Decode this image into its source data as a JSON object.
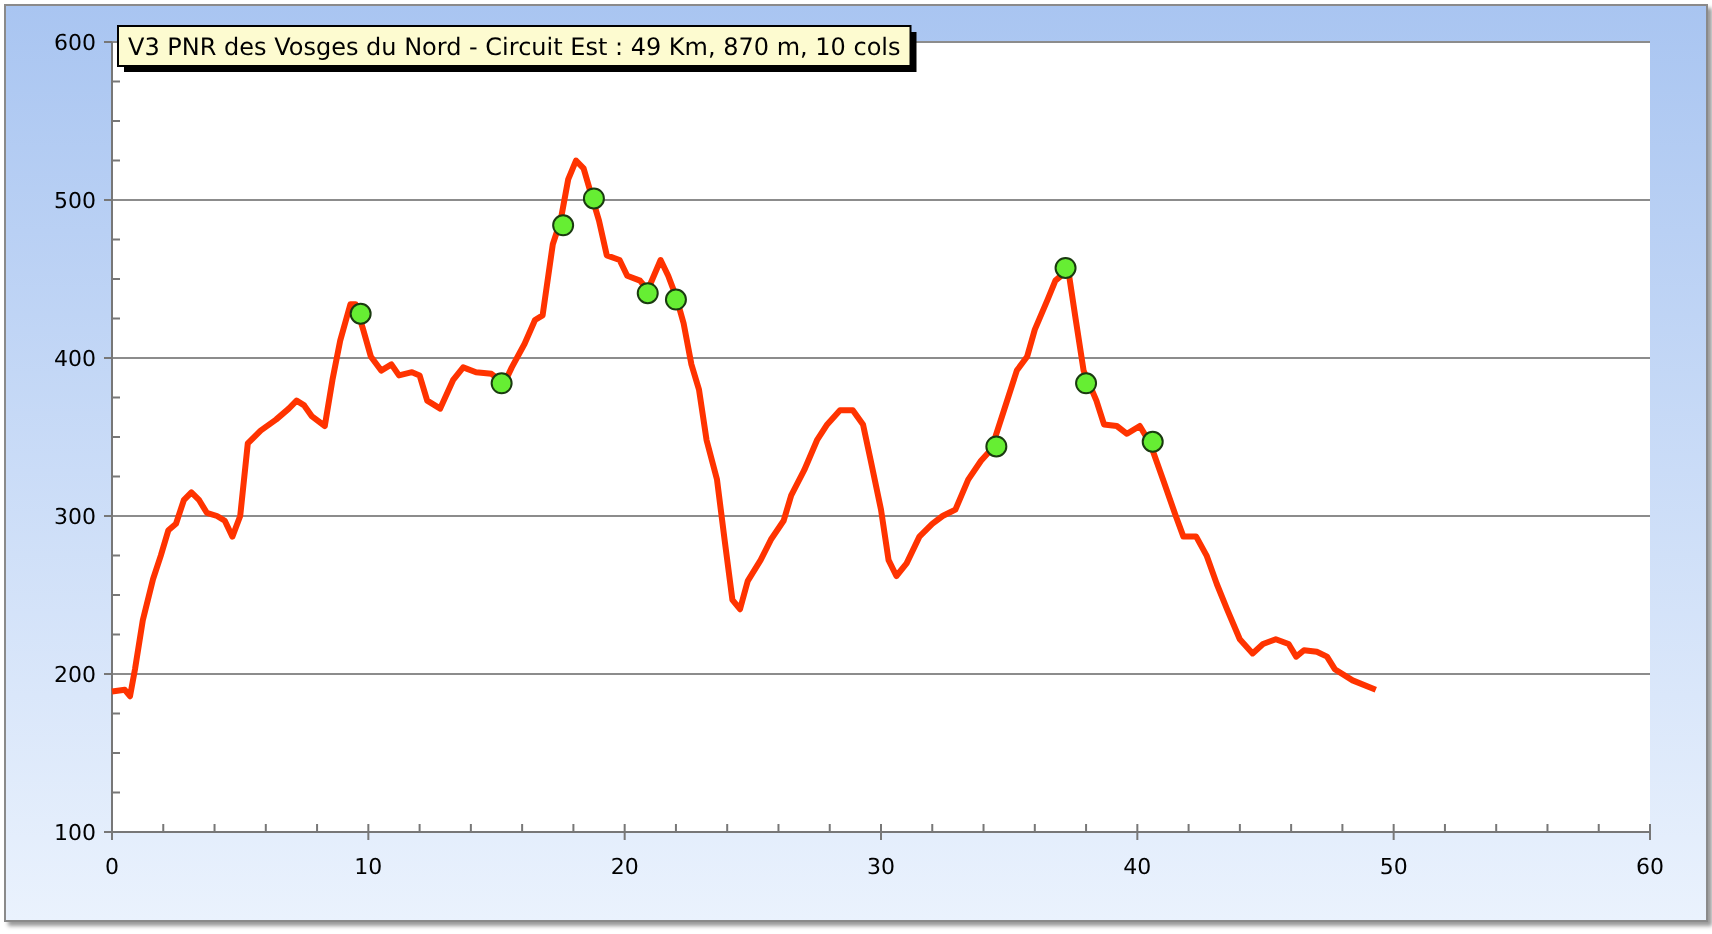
{
  "chart_data": {
    "type": "line",
    "title": "V3 PNR des Vosges du Nord - Circuit Est : 49 Km, 870 m, 10 cols",
    "grid": true,
    "xlim": [
      0,
      60
    ],
    "ylim": [
      100,
      600
    ],
    "xticks": [
      0,
      10,
      20,
      30,
      40,
      50,
      60
    ],
    "yticks": [
      100,
      200,
      300,
      400,
      500,
      600
    ],
    "series": [
      {
        "color": "#ff3300",
        "x": [
          0,
          0.5,
          0.7,
          0.9,
          1.2,
          1.6,
          1.9,
          2.2,
          2.5,
          2.8,
          3.1,
          3.4,
          3.7,
          4.1,
          4.4,
          4.7,
          5.0,
          5.3,
          5.8,
          6.4,
          6.9,
          7.2,
          7.5,
          7.8,
          8.3,
          8.6,
          8.9,
          9.3,
          9.5,
          9.8,
          10.1,
          10.5,
          10.9,
          11.2,
          11.7,
          12.0,
          12.3,
          12.8,
          13.3,
          13.7,
          14.2,
          14.8,
          15.3,
          15.6,
          16.1,
          16.5,
          16.8,
          17.2,
          17.5,
          17.8,
          18.1,
          18.4,
          18.7,
          19.0,
          19.3,
          19.8,
          20.1,
          20.6,
          20.9,
          21.4,
          21.7,
          22.0,
          22.3,
          22.6,
          22.9,
          23.2,
          23.6,
          23.9,
          24.2,
          24.5,
          24.8,
          25.3,
          25.7,
          26.2,
          26.5,
          27.0,
          27.5,
          27.9,
          28.4,
          28.9,
          29.3,
          29.6,
          30.0,
          30.3,
          30.6,
          31.0,
          31.5,
          32.0,
          32.4,
          32.9,
          33.4,
          33.9,
          34.3,
          34.8,
          35.3,
          35.7,
          36.0,
          36.5,
          36.8,
          37.3,
          37.6,
          37.9,
          38.4,
          38.7,
          39.2,
          39.6,
          40.1,
          40.5,
          41.0,
          41.5,
          41.8,
          42.3,
          42.7,
          43.1,
          43.5,
          44.0,
          44.5,
          44.9,
          45.4,
          45.9,
          46.2,
          46.5,
          47.0,
          47.4,
          47.7,
          48.4,
          49.3
        ],
        "values": [
          189,
          190,
          186,
          203,
          234,
          260,
          275,
          291,
          295,
          310,
          315,
          310,
          302,
          300,
          297,
          287,
          300,
          346,
          354,
          361,
          368,
          373,
          370,
          363,
          357,
          386,
          411,
          434,
          434,
          418,
          401,
          392,
          396,
          389,
          391,
          389,
          373,
          368,
          386,
          394,
          391,
          390,
          384,
          394,
          409,
          424,
          427,
          472,
          487,
          513,
          525,
          520,
          503,
          487,
          465,
          462,
          452,
          449,
          443,
          462,
          452,
          439,
          422,
          396,
          380,
          348,
          323,
          285,
          247,
          241,
          259,
          272,
          285,
          297,
          313,
          329,
          348,
          358,
          367,
          367,
          358,
          335,
          304,
          272,
          262,
          270,
          287,
          295,
          300,
          304,
          323,
          335,
          342,
          367,
          392,
          401,
          418,
          437,
          449,
          456,
          424,
          392,
          373,
          358,
          357,
          352,
          357,
          346,
          323,
          300,
          287,
          287,
          275,
          257,
          241,
          222,
          213,
          219,
          222,
          219,
          211,
          215,
          214,
          211,
          203,
          196,
          190
        ]
      },
      {
        "type": "scatter",
        "color": "#66ee33",
        "x": [
          9.7,
          15.2,
          17.6,
          18.8,
          20.9,
          22.0,
          34.5,
          37.2,
          38.0,
          40.6
        ],
        "values": [
          428,
          384,
          484,
          501,
          441,
          437,
          344,
          457,
          384,
          347
        ]
      }
    ]
  }
}
